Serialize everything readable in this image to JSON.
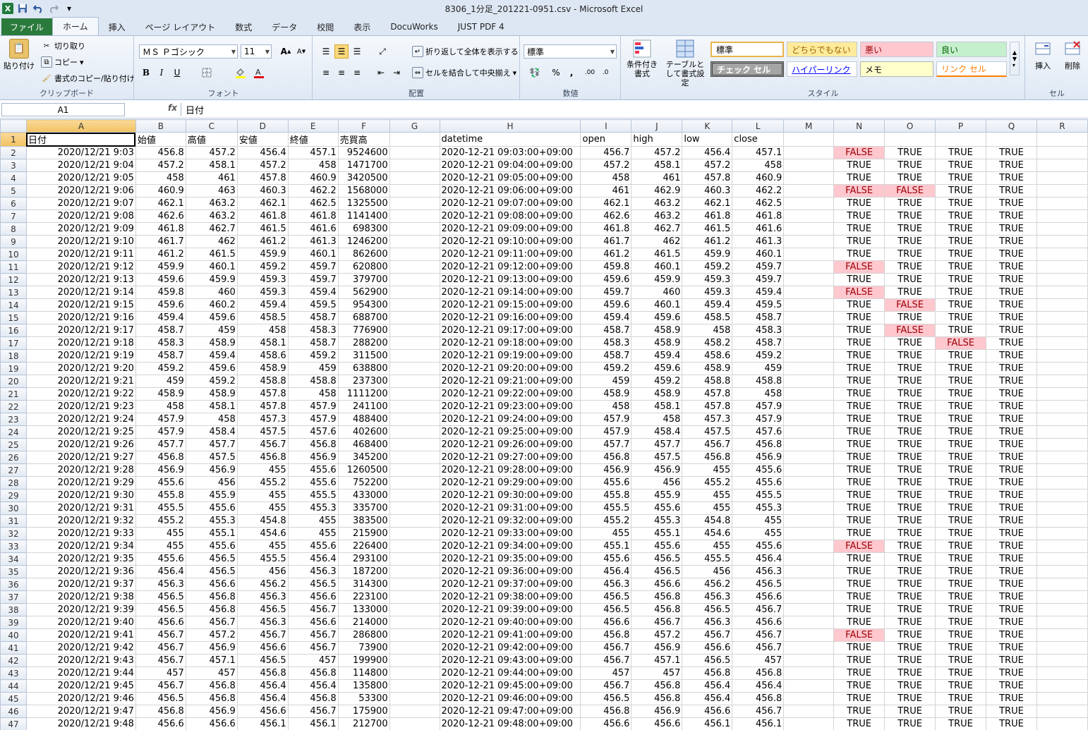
{
  "window": {
    "title": "8306_1分足_201221-0951.csv  -  Microsoft Excel",
    "logo": "X"
  },
  "qat": {
    "save": "save-icon",
    "undo": "undo-icon",
    "redo": "redo-icon"
  },
  "tabs": [
    "ファイル",
    "ホーム",
    "挿入",
    "ページ レイアウト",
    "数式",
    "データ",
    "校閲",
    "表示",
    "DocuWorks",
    "JUST PDF 4"
  ],
  "ribbon": {
    "clipboard": {
      "paste": "貼り付け",
      "cut": "切り取り",
      "copy": "コピー",
      "format_painter": "書式のコピー/貼り付け",
      "label": "クリップボード"
    },
    "font": {
      "name": "ＭＳ Ｐゴシック",
      "size": "11",
      "bold": "B",
      "italic": "I",
      "underline": "U",
      "label": "フォント"
    },
    "alignment": {
      "wrap": "折り返して全体を表示する",
      "merge": "セルを結合して中央揃え",
      "label": "配置"
    },
    "number": {
      "format": "標準",
      "percent": "%",
      "comma": ",",
      "label": "数値"
    },
    "styles": {
      "conditional": "条件付き書式",
      "table": "テーブルとして書式設定",
      "cells": [
        "標準",
        "どちらでもない",
        "悪い",
        "良い",
        "チェック セル",
        "ハイパーリンク",
        "メモ",
        "リンク セル"
      ],
      "label": "スタイル"
    },
    "cells": {
      "insert": "挿入",
      "delete": "削除",
      "label": "セル"
    }
  },
  "formula_bar": {
    "name_box": "A1",
    "fx": "fx",
    "content": "日付"
  },
  "columns": [
    "A",
    "B",
    "C",
    "D",
    "E",
    "F",
    "G",
    "H",
    "I",
    "J",
    "K",
    "L",
    "M",
    "N",
    "O",
    "P",
    "Q",
    "R"
  ],
  "header_row": [
    "日付",
    "始値",
    "高値",
    "安値",
    "終値",
    "売買高",
    "",
    "datetime",
    "open",
    "high",
    "low",
    "close",
    "",
    "",
    "",
    "",
    ""
  ],
  "rows": [
    [
      "2020/12/21  9:03",
      "456.8",
      "457.2",
      "456.4",
      "457.1",
      "9524600",
      "",
      "2020-12-21  09:03:00+09:00",
      "456.7",
      "457.2",
      "456.4",
      "457.1",
      "",
      "FALSE",
      "TRUE",
      "TRUE",
      "TRUE"
    ],
    [
      "2020/12/21  9:04",
      "457.2",
      "458.1",
      "457.2",
      "458",
      "1471700",
      "",
      "2020-12-21  09:04:00+09:00",
      "457.2",
      "458.1",
      "457.2",
      "458",
      "",
      "TRUE",
      "TRUE",
      "TRUE",
      "TRUE"
    ],
    [
      "2020/12/21  9:05",
      "458",
      "461",
      "457.8",
      "460.9",
      "3420500",
      "",
      "2020-12-21  09:05:00+09:00",
      "458",
      "461",
      "457.8",
      "460.9",
      "",
      "TRUE",
      "TRUE",
      "TRUE",
      "TRUE"
    ],
    [
      "2020/12/21  9:06",
      "460.9",
      "463",
      "460.3",
      "462.2",
      "1568000",
      "",
      "2020-12-21  09:06:00+09:00",
      "461",
      "462.9",
      "460.3",
      "462.2",
      "",
      "FALSE",
      "FALSE",
      "TRUE",
      "TRUE"
    ],
    [
      "2020/12/21  9:07",
      "462.1",
      "463.2",
      "462.1",
      "462.5",
      "1325500",
      "",
      "2020-12-21  09:07:00+09:00",
      "462.1",
      "463.2",
      "462.1",
      "462.5",
      "",
      "TRUE",
      "TRUE",
      "TRUE",
      "TRUE"
    ],
    [
      "2020/12/21  9:08",
      "462.6",
      "463.2",
      "461.8",
      "461.8",
      "1141400",
      "",
      "2020-12-21  09:08:00+09:00",
      "462.6",
      "463.2",
      "461.8",
      "461.8",
      "",
      "TRUE",
      "TRUE",
      "TRUE",
      "TRUE"
    ],
    [
      "2020/12/21  9:09",
      "461.8",
      "462.7",
      "461.5",
      "461.6",
      "698300",
      "",
      "2020-12-21  09:09:00+09:00",
      "461.8",
      "462.7",
      "461.5",
      "461.6",
      "",
      "TRUE",
      "TRUE",
      "TRUE",
      "TRUE"
    ],
    [
      "2020/12/21  9:10",
      "461.7",
      "462",
      "461.2",
      "461.3",
      "1246200",
      "",
      "2020-12-21  09:10:00+09:00",
      "461.7",
      "462",
      "461.2",
      "461.3",
      "",
      "TRUE",
      "TRUE",
      "TRUE",
      "TRUE"
    ],
    [
      "2020/12/21  9:11",
      "461.2",
      "461.5",
      "459.9",
      "460.1",
      "862600",
      "",
      "2020-12-21  09:11:00+09:00",
      "461.2",
      "461.5",
      "459.9",
      "460.1",
      "",
      "TRUE",
      "TRUE",
      "TRUE",
      "TRUE"
    ],
    [
      "2020/12/21  9:12",
      "459.9",
      "460.1",
      "459.2",
      "459.7",
      "620800",
      "",
      "2020-12-21  09:12:00+09:00",
      "459.8",
      "460.1",
      "459.2",
      "459.7",
      "",
      "FALSE",
      "TRUE",
      "TRUE",
      "TRUE"
    ],
    [
      "2020/12/21  9:13",
      "459.6",
      "459.9",
      "459.3",
      "459.7",
      "379700",
      "",
      "2020-12-21  09:13:00+09:00",
      "459.6",
      "459.9",
      "459.3",
      "459.7",
      "",
      "TRUE",
      "TRUE",
      "TRUE",
      "TRUE"
    ],
    [
      "2020/12/21  9:14",
      "459.8",
      "460",
      "459.3",
      "459.4",
      "562900",
      "",
      "2020-12-21  09:14:00+09:00",
      "459.7",
      "460",
      "459.3",
      "459.4",
      "",
      "FALSE",
      "TRUE",
      "TRUE",
      "TRUE"
    ],
    [
      "2020/12/21  9:15",
      "459.6",
      "460.2",
      "459.4",
      "459.5",
      "954300",
      "",
      "2020-12-21  09:15:00+09:00",
      "459.6",
      "460.1",
      "459.4",
      "459.5",
      "",
      "TRUE",
      "FALSE",
      "TRUE",
      "TRUE"
    ],
    [
      "2020/12/21  9:16",
      "459.4",
      "459.6",
      "458.5",
      "458.7",
      "688700",
      "",
      "2020-12-21  09:16:00+09:00",
      "459.4",
      "459.6",
      "458.5",
      "458.7",
      "",
      "TRUE",
      "TRUE",
      "TRUE",
      "TRUE"
    ],
    [
      "2020/12/21  9:17",
      "458.7",
      "459",
      "458",
      "458.3",
      "776900",
      "",
      "2020-12-21  09:17:00+09:00",
      "458.7",
      "458.9",
      "458",
      "458.3",
      "",
      "TRUE",
      "FALSE",
      "TRUE",
      "TRUE"
    ],
    [
      "2020/12/21  9:18",
      "458.3",
      "458.9",
      "458.1",
      "458.7",
      "288200",
      "",
      "2020-12-21  09:18:00+09:00",
      "458.3",
      "458.9",
      "458.2",
      "458.7",
      "",
      "TRUE",
      "TRUE",
      "FALSE",
      "TRUE"
    ],
    [
      "2020/12/21  9:19",
      "458.7",
      "459.4",
      "458.6",
      "459.2",
      "311500",
      "",
      "2020-12-21  09:19:00+09:00",
      "458.7",
      "459.4",
      "458.6",
      "459.2",
      "",
      "TRUE",
      "TRUE",
      "TRUE",
      "TRUE"
    ],
    [
      "2020/12/21  9:20",
      "459.2",
      "459.6",
      "458.9",
      "459",
      "638800",
      "",
      "2020-12-21  09:20:00+09:00",
      "459.2",
      "459.6",
      "458.9",
      "459",
      "",
      "TRUE",
      "TRUE",
      "TRUE",
      "TRUE"
    ],
    [
      "2020/12/21  9:21",
      "459",
      "459.2",
      "458.8",
      "458.8",
      "237300",
      "",
      "2020-12-21  09:21:00+09:00",
      "459",
      "459.2",
      "458.8",
      "458.8",
      "",
      "TRUE",
      "TRUE",
      "TRUE",
      "TRUE"
    ],
    [
      "2020/12/21  9:22",
      "458.9",
      "458.9",
      "457.8",
      "458",
      "1111200",
      "",
      "2020-12-21  09:22:00+09:00",
      "458.9",
      "458.9",
      "457.8",
      "458",
      "",
      "TRUE",
      "TRUE",
      "TRUE",
      "TRUE"
    ],
    [
      "2020/12/21  9:23",
      "458",
      "458.1",
      "457.8",
      "457.9",
      "241100",
      "",
      "2020-12-21  09:23:00+09:00",
      "458",
      "458.1",
      "457.8",
      "457.9",
      "",
      "TRUE",
      "TRUE",
      "TRUE",
      "TRUE"
    ],
    [
      "2020/12/21  9:24",
      "457.9",
      "458",
      "457.3",
      "457.9",
      "488400",
      "",
      "2020-12-21  09:24:00+09:00",
      "457.9",
      "458",
      "457.3",
      "457.9",
      "",
      "TRUE",
      "TRUE",
      "TRUE",
      "TRUE"
    ],
    [
      "2020/12/21  9:25",
      "457.9",
      "458.4",
      "457.5",
      "457.6",
      "402600",
      "",
      "2020-12-21  09:25:00+09:00",
      "457.9",
      "458.4",
      "457.5",
      "457.6",
      "",
      "TRUE",
      "TRUE",
      "TRUE",
      "TRUE"
    ],
    [
      "2020/12/21  9:26",
      "457.7",
      "457.7",
      "456.7",
      "456.8",
      "468400",
      "",
      "2020-12-21  09:26:00+09:00",
      "457.7",
      "457.7",
      "456.7",
      "456.8",
      "",
      "TRUE",
      "TRUE",
      "TRUE",
      "TRUE"
    ],
    [
      "2020/12/21  9:27",
      "456.8",
      "457.5",
      "456.8",
      "456.9",
      "345200",
      "",
      "2020-12-21  09:27:00+09:00",
      "456.8",
      "457.5",
      "456.8",
      "456.9",
      "",
      "TRUE",
      "TRUE",
      "TRUE",
      "TRUE"
    ],
    [
      "2020/12/21  9:28",
      "456.9",
      "456.9",
      "455",
      "455.6",
      "1260500",
      "",
      "2020-12-21  09:28:00+09:00",
      "456.9",
      "456.9",
      "455",
      "455.6",
      "",
      "TRUE",
      "TRUE",
      "TRUE",
      "TRUE"
    ],
    [
      "2020/12/21  9:29",
      "455.6",
      "456",
      "455.2",
      "455.6",
      "752200",
      "",
      "2020-12-21  09:29:00+09:00",
      "455.6",
      "456",
      "455.2",
      "455.6",
      "",
      "TRUE",
      "TRUE",
      "TRUE",
      "TRUE"
    ],
    [
      "2020/12/21  9:30",
      "455.8",
      "455.9",
      "455",
      "455.5",
      "433000",
      "",
      "2020-12-21  09:30:00+09:00",
      "455.8",
      "455.9",
      "455",
      "455.5",
      "",
      "TRUE",
      "TRUE",
      "TRUE",
      "TRUE"
    ],
    [
      "2020/12/21  9:31",
      "455.5",
      "455.6",
      "455",
      "455.3",
      "335700",
      "",
      "2020-12-21  09:31:00+09:00",
      "455.5",
      "455.6",
      "455",
      "455.3",
      "",
      "TRUE",
      "TRUE",
      "TRUE",
      "TRUE"
    ],
    [
      "2020/12/21  9:32",
      "455.2",
      "455.3",
      "454.8",
      "455",
      "383500",
      "",
      "2020-12-21  09:32:00+09:00",
      "455.2",
      "455.3",
      "454.8",
      "455",
      "",
      "TRUE",
      "TRUE",
      "TRUE",
      "TRUE"
    ],
    [
      "2020/12/21  9:33",
      "455",
      "455.1",
      "454.6",
      "455",
      "215900",
      "",
      "2020-12-21  09:33:00+09:00",
      "455",
      "455.1",
      "454.6",
      "455",
      "",
      "TRUE",
      "TRUE",
      "TRUE",
      "TRUE"
    ],
    [
      "2020/12/21  9:34",
      "455",
      "455.6",
      "455",
      "455.6",
      "226400",
      "",
      "2020-12-21  09:34:00+09:00",
      "455.1",
      "455.6",
      "455",
      "455.6",
      "",
      "FALSE",
      "TRUE",
      "TRUE",
      "TRUE"
    ],
    [
      "2020/12/21  9:35",
      "455.6",
      "456.5",
      "455.5",
      "456.4",
      "293100",
      "",
      "2020-12-21  09:35:00+09:00",
      "455.6",
      "456.5",
      "455.5",
      "456.4",
      "",
      "TRUE",
      "TRUE",
      "TRUE",
      "TRUE"
    ],
    [
      "2020/12/21  9:36",
      "456.4",
      "456.5",
      "456",
      "456.3",
      "187200",
      "",
      "2020-12-21  09:36:00+09:00",
      "456.4",
      "456.5",
      "456",
      "456.3",
      "",
      "TRUE",
      "TRUE",
      "TRUE",
      "TRUE"
    ],
    [
      "2020/12/21  9:37",
      "456.3",
      "456.6",
      "456.2",
      "456.5",
      "314300",
      "",
      "2020-12-21  09:37:00+09:00",
      "456.3",
      "456.6",
      "456.2",
      "456.5",
      "",
      "TRUE",
      "TRUE",
      "TRUE",
      "TRUE"
    ],
    [
      "2020/12/21  9:38",
      "456.5",
      "456.8",
      "456.3",
      "456.6",
      "223100",
      "",
      "2020-12-21  09:38:00+09:00",
      "456.5",
      "456.8",
      "456.3",
      "456.6",
      "",
      "TRUE",
      "TRUE",
      "TRUE",
      "TRUE"
    ],
    [
      "2020/12/21  9:39",
      "456.5",
      "456.8",
      "456.5",
      "456.7",
      "133000",
      "",
      "2020-12-21  09:39:00+09:00",
      "456.5",
      "456.8",
      "456.5",
      "456.7",
      "",
      "TRUE",
      "TRUE",
      "TRUE",
      "TRUE"
    ],
    [
      "2020/12/21  9:40",
      "456.6",
      "456.7",
      "456.3",
      "456.6",
      "214000",
      "",
      "2020-12-21  09:40:00+09:00",
      "456.6",
      "456.7",
      "456.3",
      "456.6",
      "",
      "TRUE",
      "TRUE",
      "TRUE",
      "TRUE"
    ],
    [
      "2020/12/21  9:41",
      "456.7",
      "457.2",
      "456.7",
      "456.7",
      "286800",
      "",
      "2020-12-21  09:41:00+09:00",
      "456.8",
      "457.2",
      "456.7",
      "456.7",
      "",
      "FALSE",
      "TRUE",
      "TRUE",
      "TRUE"
    ],
    [
      "2020/12/21  9:42",
      "456.7",
      "456.9",
      "456.6",
      "456.7",
      "73900",
      "",
      "2020-12-21  09:42:00+09:00",
      "456.7",
      "456.9",
      "456.6",
      "456.7",
      "",
      "TRUE",
      "TRUE",
      "TRUE",
      "TRUE"
    ],
    [
      "2020/12/21  9:43",
      "456.7",
      "457.1",
      "456.5",
      "457",
      "199900",
      "",
      "2020-12-21  09:43:00+09:00",
      "456.7",
      "457.1",
      "456.5",
      "457",
      "",
      "TRUE",
      "TRUE",
      "TRUE",
      "TRUE"
    ],
    [
      "2020/12/21  9:44",
      "457",
      "457",
      "456.8",
      "456.8",
      "114800",
      "",
      "2020-12-21  09:44:00+09:00",
      "457",
      "457",
      "456.8",
      "456.8",
      "",
      "TRUE",
      "TRUE",
      "TRUE",
      "TRUE"
    ],
    [
      "2020/12/21  9:45",
      "456.7",
      "456.8",
      "456.4",
      "456.4",
      "135800",
      "",
      "2020-12-21  09:45:00+09:00",
      "456.7",
      "456.8",
      "456.4",
      "456.4",
      "",
      "TRUE",
      "TRUE",
      "TRUE",
      "TRUE"
    ],
    [
      "2020/12/21  9:46",
      "456.5",
      "456.8",
      "456.4",
      "456.8",
      "53300",
      "",
      "2020-12-21  09:46:00+09:00",
      "456.5",
      "456.8",
      "456.4",
      "456.8",
      "",
      "TRUE",
      "TRUE",
      "TRUE",
      "TRUE"
    ],
    [
      "2020/12/21  9:47",
      "456.8",
      "456.9",
      "456.6",
      "456.7",
      "175900",
      "",
      "2020-12-21  09:47:00+09:00",
      "456.8",
      "456.9",
      "456.6",
      "456.7",
      "",
      "TRUE",
      "TRUE",
      "TRUE",
      "TRUE"
    ],
    [
      "2020/12/21  9:48",
      "456.6",
      "456.6",
      "456.1",
      "456.1",
      "212700",
      "",
      "2020-12-21  09:48:00+09:00",
      "456.6",
      "456.6",
      "456.1",
      "456.1",
      "",
      "TRUE",
      "TRUE",
      "TRUE",
      "TRUE"
    ]
  ]
}
